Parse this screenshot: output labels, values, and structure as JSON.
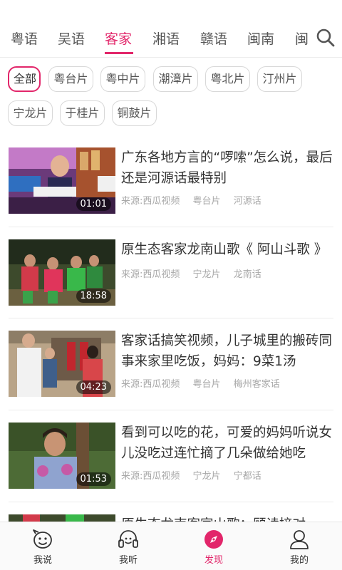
{
  "tabs": [
    {
      "label": "粤语"
    },
    {
      "label": "吴语"
    },
    {
      "label": "客家"
    },
    {
      "label": "湘语"
    },
    {
      "label": "赣语"
    },
    {
      "label": "闽南"
    },
    {
      "label": "闽"
    }
  ],
  "active_tab": "客家",
  "chips": [
    {
      "label": "全部"
    },
    {
      "label": "粤台片"
    },
    {
      "label": "粤中片"
    },
    {
      "label": "潮漳片"
    },
    {
      "label": "粤北片"
    },
    {
      "label": "汀州片"
    },
    {
      "label": "宁龙片"
    },
    {
      "label": "于桂片"
    },
    {
      "label": "铜鼓片"
    }
  ],
  "active_chip": "全部",
  "feed": [
    {
      "title": "广东各地方言的“啰嗦”怎么说，最后还是河源话最特别",
      "source": "来源:西瓜视频",
      "region": "粤台片",
      "dialect": "河源话",
      "duration": "01:01"
    },
    {
      "title": "原生态客家龙南山歌《 阿山斗歌 》",
      "source": "来源:西瓜视频",
      "region": "宁龙片",
      "dialect": "龙南话",
      "duration": "18:58"
    },
    {
      "title": "客家话搞笑视频，儿子城里的搬砖同事来家里吃饭，妈妈：9菜1汤",
      "source": "来源:西瓜视频",
      "region": "粤台片",
      "dialect": "梅州客家话",
      "duration": "04:23"
    },
    {
      "title": "看到可以吃的花，可爱的妈妈听说女儿没吃过连忙摘了几朵做给她吃",
      "source": "来源:西瓜视频",
      "region": "宁龙片",
      "dialect": "宁都话",
      "duration": "01:53"
    },
    {
      "title": "原生态龙南客家山歌：顾读接对",
      "source": "",
      "region": "",
      "dialect": "",
      "duration": ""
    }
  ],
  "nav": [
    {
      "label": "我说",
      "icon": "speech-bubble-icon"
    },
    {
      "label": "我听",
      "icon": "headphones-icon"
    },
    {
      "label": "发现",
      "icon": "compass-icon"
    },
    {
      "label": "我的",
      "icon": "user-icon"
    }
  ],
  "active_nav": "发现",
  "colors": {
    "accent": "#e2266a",
    "text": "#333333",
    "muted": "#a8a8a8",
    "chip_border": "#d8d8d8"
  }
}
